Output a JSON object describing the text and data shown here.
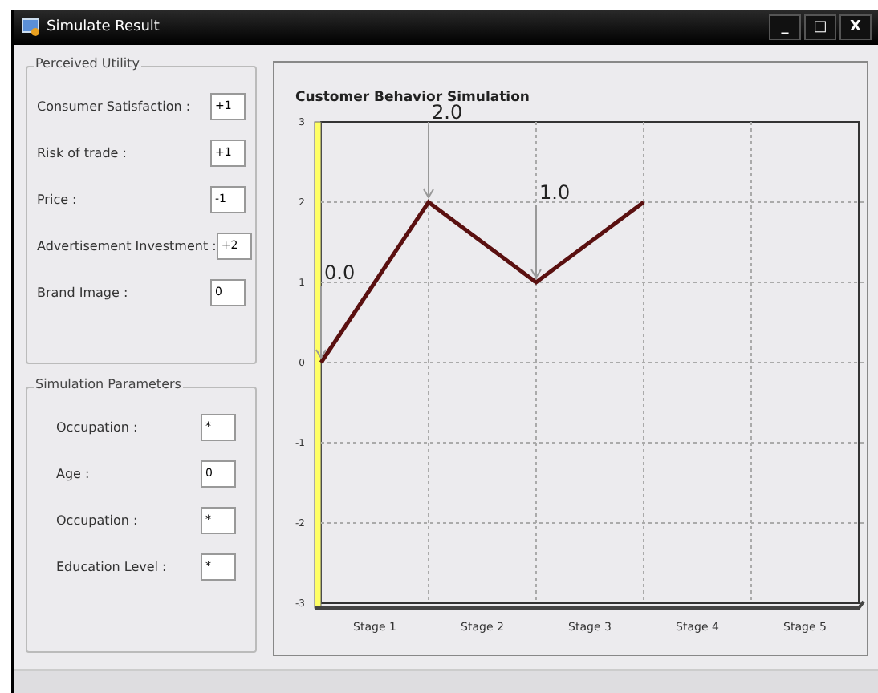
{
  "window": {
    "title": "Simulate Result",
    "controls": [
      "_",
      "□",
      "X"
    ]
  },
  "groups": [
    {
      "title": "Perceived Utility",
      "fields": [
        {
          "label": "Consumer Satisfaction :",
          "value": "+1"
        },
        {
          "label": "Risk of trade :",
          "value": "+1"
        },
        {
          "label": "Price :",
          "value": "-1"
        },
        {
          "label": "Advertisement Investment :",
          "value": "+2"
        },
        {
          "label": "Brand Image :",
          "value": "0"
        }
      ]
    },
    {
      "title": "Simulation Parameters",
      "fields": [
        {
          "label": "Occupation :",
          "value": "*"
        },
        {
          "label": "Age :",
          "value": "0"
        },
        {
          "label": "Occupation :",
          "value": "*"
        },
        {
          "label": "Education Level  :",
          "value": "*"
        }
      ]
    }
  ],
  "chart": {
    "chart_data": {
      "type": "line",
      "title": "Customer Behavior Simulation",
      "grid": true,
      "categories": [
        null,
        "Stage 1",
        null,
        "Stage 2",
        null,
        "Stage 3",
        null,
        "Stage 4",
        null,
        "Stage 5",
        null
      ],
      "series": [
        {
          "color": "#5a1010",
          "values": [
            0,
            1,
            2,
            1.5,
            1,
            1.5,
            2,
            null,
            null,
            null,
            null
          ]
        }
      ],
      "ylim": [
        -3,
        3
      ],
      "yticks": [
        3,
        2,
        1,
        0,
        -1,
        -2,
        -3
      ],
      "annotations": [
        "0.0",
        "2.0",
        "1.0"
      ]
    }
  }
}
